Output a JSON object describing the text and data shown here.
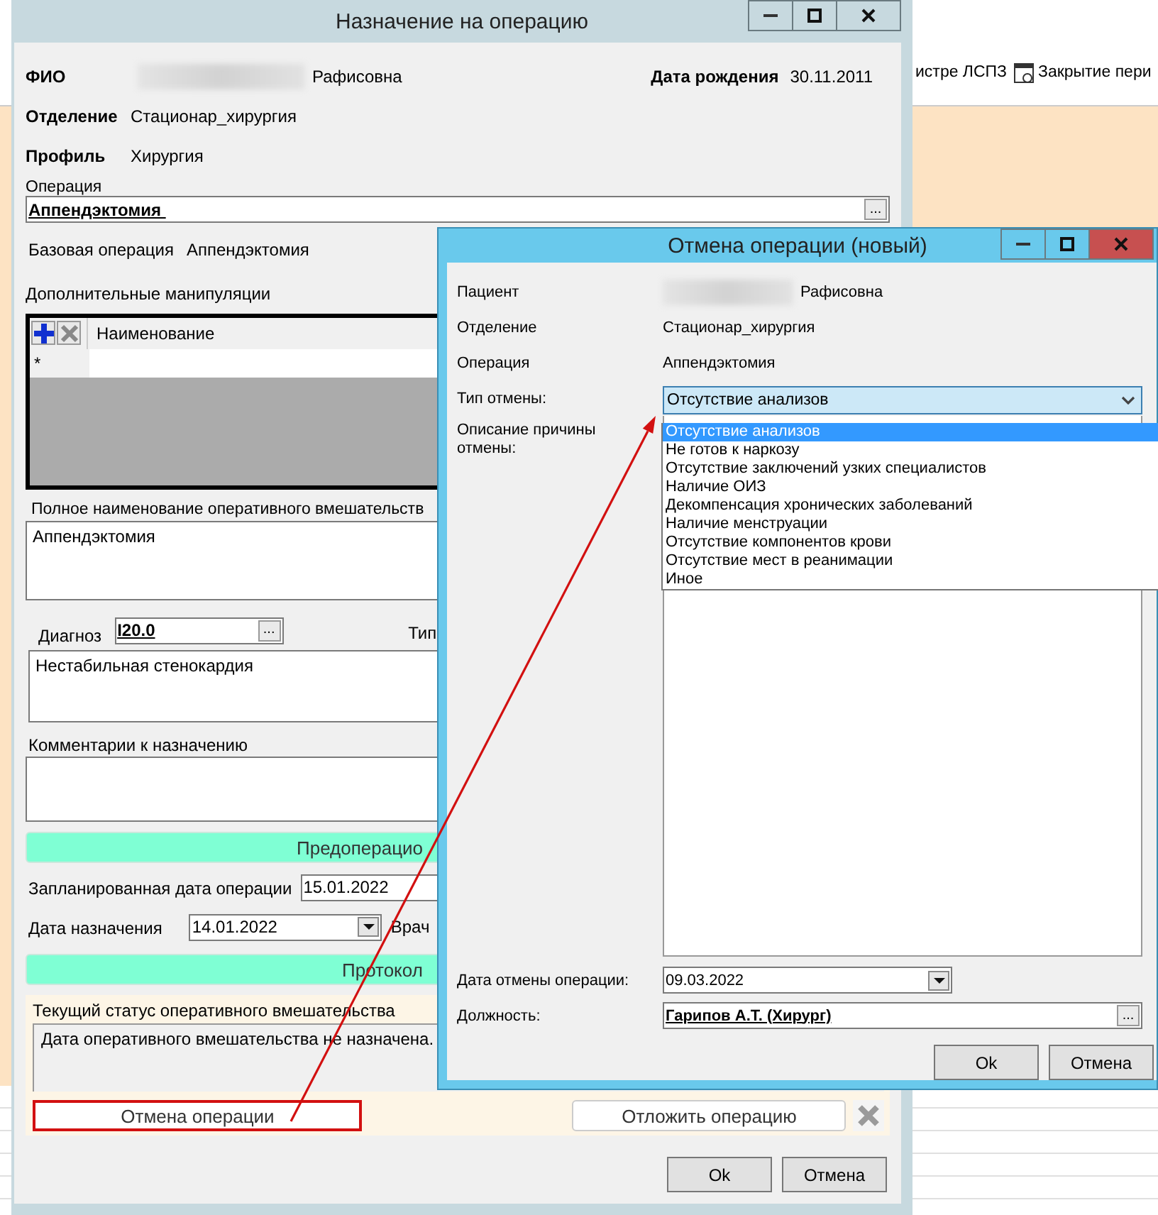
{
  "background_app": {
    "toolbar": [
      {
        "label": "истре ЛСПЗ",
        "kind": "text"
      },
      {
        "label": "Закрытие пери",
        "kind": "icon"
      }
    ]
  },
  "main_dialog": {
    "title": "Назначение на операцию",
    "fio_label": "ФИО",
    "fio_suffix": "Рафисовна",
    "birth_label": "Дата рождения",
    "birth_date": "30.11.2011",
    "department_label": "Отделение",
    "department": "Стационар_хирургия",
    "profile_label": "Профиль",
    "profile": "Хирургия",
    "operation_label": "Операция",
    "operation": "Аппендэктомия ",
    "operation_browse": "...",
    "base_operation_label": "Базовая операция",
    "base_operation": "Аппендэктомия",
    "extra_label": "Дополнительные манипуляции",
    "extra_column": "Наименование",
    "extra_new_row": "*",
    "full_name_label": "Полное наименование оперативного вмешательств",
    "full_name": "Аппендэктомия",
    "diagnosis_label": "Диагноз",
    "diagnosis_code": "I20.0",
    "diagnosis_browse": "...",
    "type_label": "Тип",
    "diagnosis_text": "Нестабильная стенокардия",
    "comments_label": "Комментарии к назначению",
    "section_1": "Предоперацио",
    "planned_date_label": "Запланированная дата операции",
    "planned_date": "15.01.2022",
    "assign_date_label": "Дата назначения",
    "assign_date": "14.01.2022",
    "doctor_label": "Врач",
    "section_2": "Протокол",
    "status_label": "Текущий статус оперативного вмешательства",
    "status_text": "Дата оперативного вмешательства не назначена.",
    "actions": [
      {
        "label": "Отмена операции",
        "highlighted": true
      },
      {
        "label": "Отложить операцию",
        "highlighted": false
      }
    ],
    "buttons": [
      "Ok",
      "Отмена"
    ]
  },
  "cancel_dialog": {
    "title": "Отмена операции (новый)",
    "patient_label": "Пациент",
    "patient_suffix": "Рафисовна",
    "department_label": "Отделение",
    "department": "Стационар_хирургия",
    "operation_label": "Операция",
    "operation": "Аппендэктомия",
    "type_label": "Тип отмены:",
    "type_value": "Отсутствие анализов",
    "type_expanded": true,
    "type_options": [
      {
        "label": "Отсутствие анализов",
        "selected": true
      },
      {
        "label": "Не готов к наркозу",
        "selected": false
      },
      {
        "label": "Отсутствие заключений узких специалистов",
        "selected": false
      },
      {
        "label": "Наличие ОИЗ",
        "selected": false
      },
      {
        "label": "Декомпенсация хронических заболеваний",
        "selected": false
      },
      {
        "label": "Наличие менструации",
        "selected": false
      },
      {
        "label": "Отсутствие компонентов крови",
        "selected": false
      },
      {
        "label": "Отсутствие мест в реанимации",
        "selected": false
      },
      {
        "label": "Иное",
        "selected": false
      }
    ],
    "reason_label": "Описание причины отмены:",
    "cancel_date_label": "Дата отмены операции:",
    "cancel_date": "09.03.2022",
    "position_label": "Должность:",
    "position": "Гарипов А.Т. (Хирург)",
    "position_browse": "...",
    "buttons": [
      "Ok",
      "Отмена"
    ]
  }
}
